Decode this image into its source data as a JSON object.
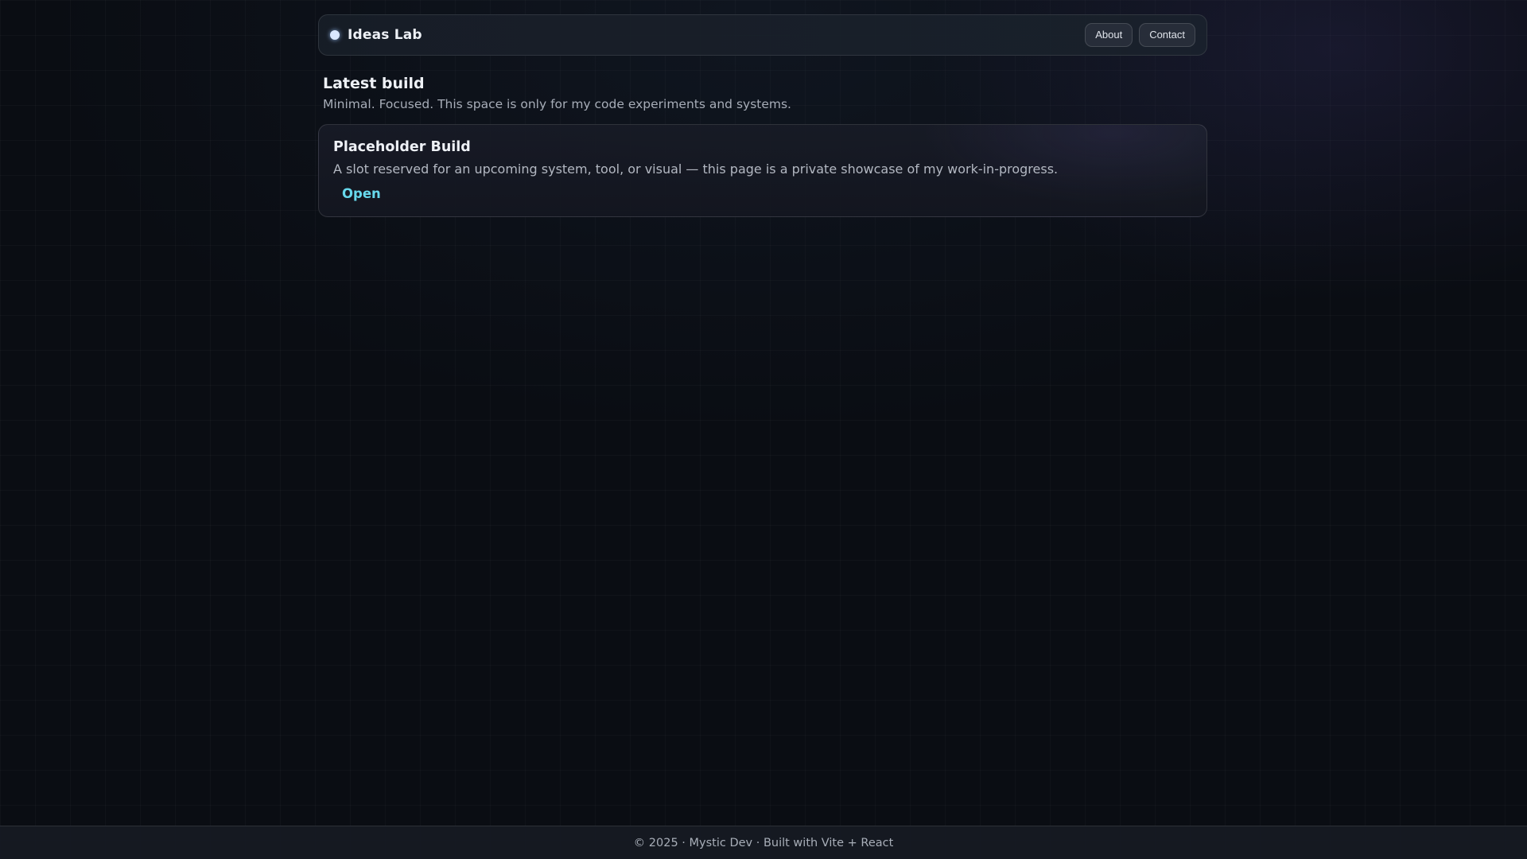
{
  "header": {
    "brand": "Ideas Lab",
    "brand_icon": "status-dot-icon",
    "nav": {
      "about_label": "About",
      "contact_label": "Contact"
    }
  },
  "main": {
    "title": "Latest build",
    "subtitle": "Minimal. Focused. This space is only for my code experiments and systems.",
    "cards": [
      {
        "title": "Placeholder Build",
        "description": "A slot reserved for an upcoming system, tool, or visual — this page is a private showcase of my work-in-progress.",
        "link_label": "Open"
      }
    ]
  },
  "footer": {
    "text": "© 2025 · Mystic Dev · Built with Vite + React"
  },
  "colors": {
    "background": "#0a0d13",
    "accent_link": "#67d8ec",
    "brand_dot": "#d9e8ff"
  }
}
